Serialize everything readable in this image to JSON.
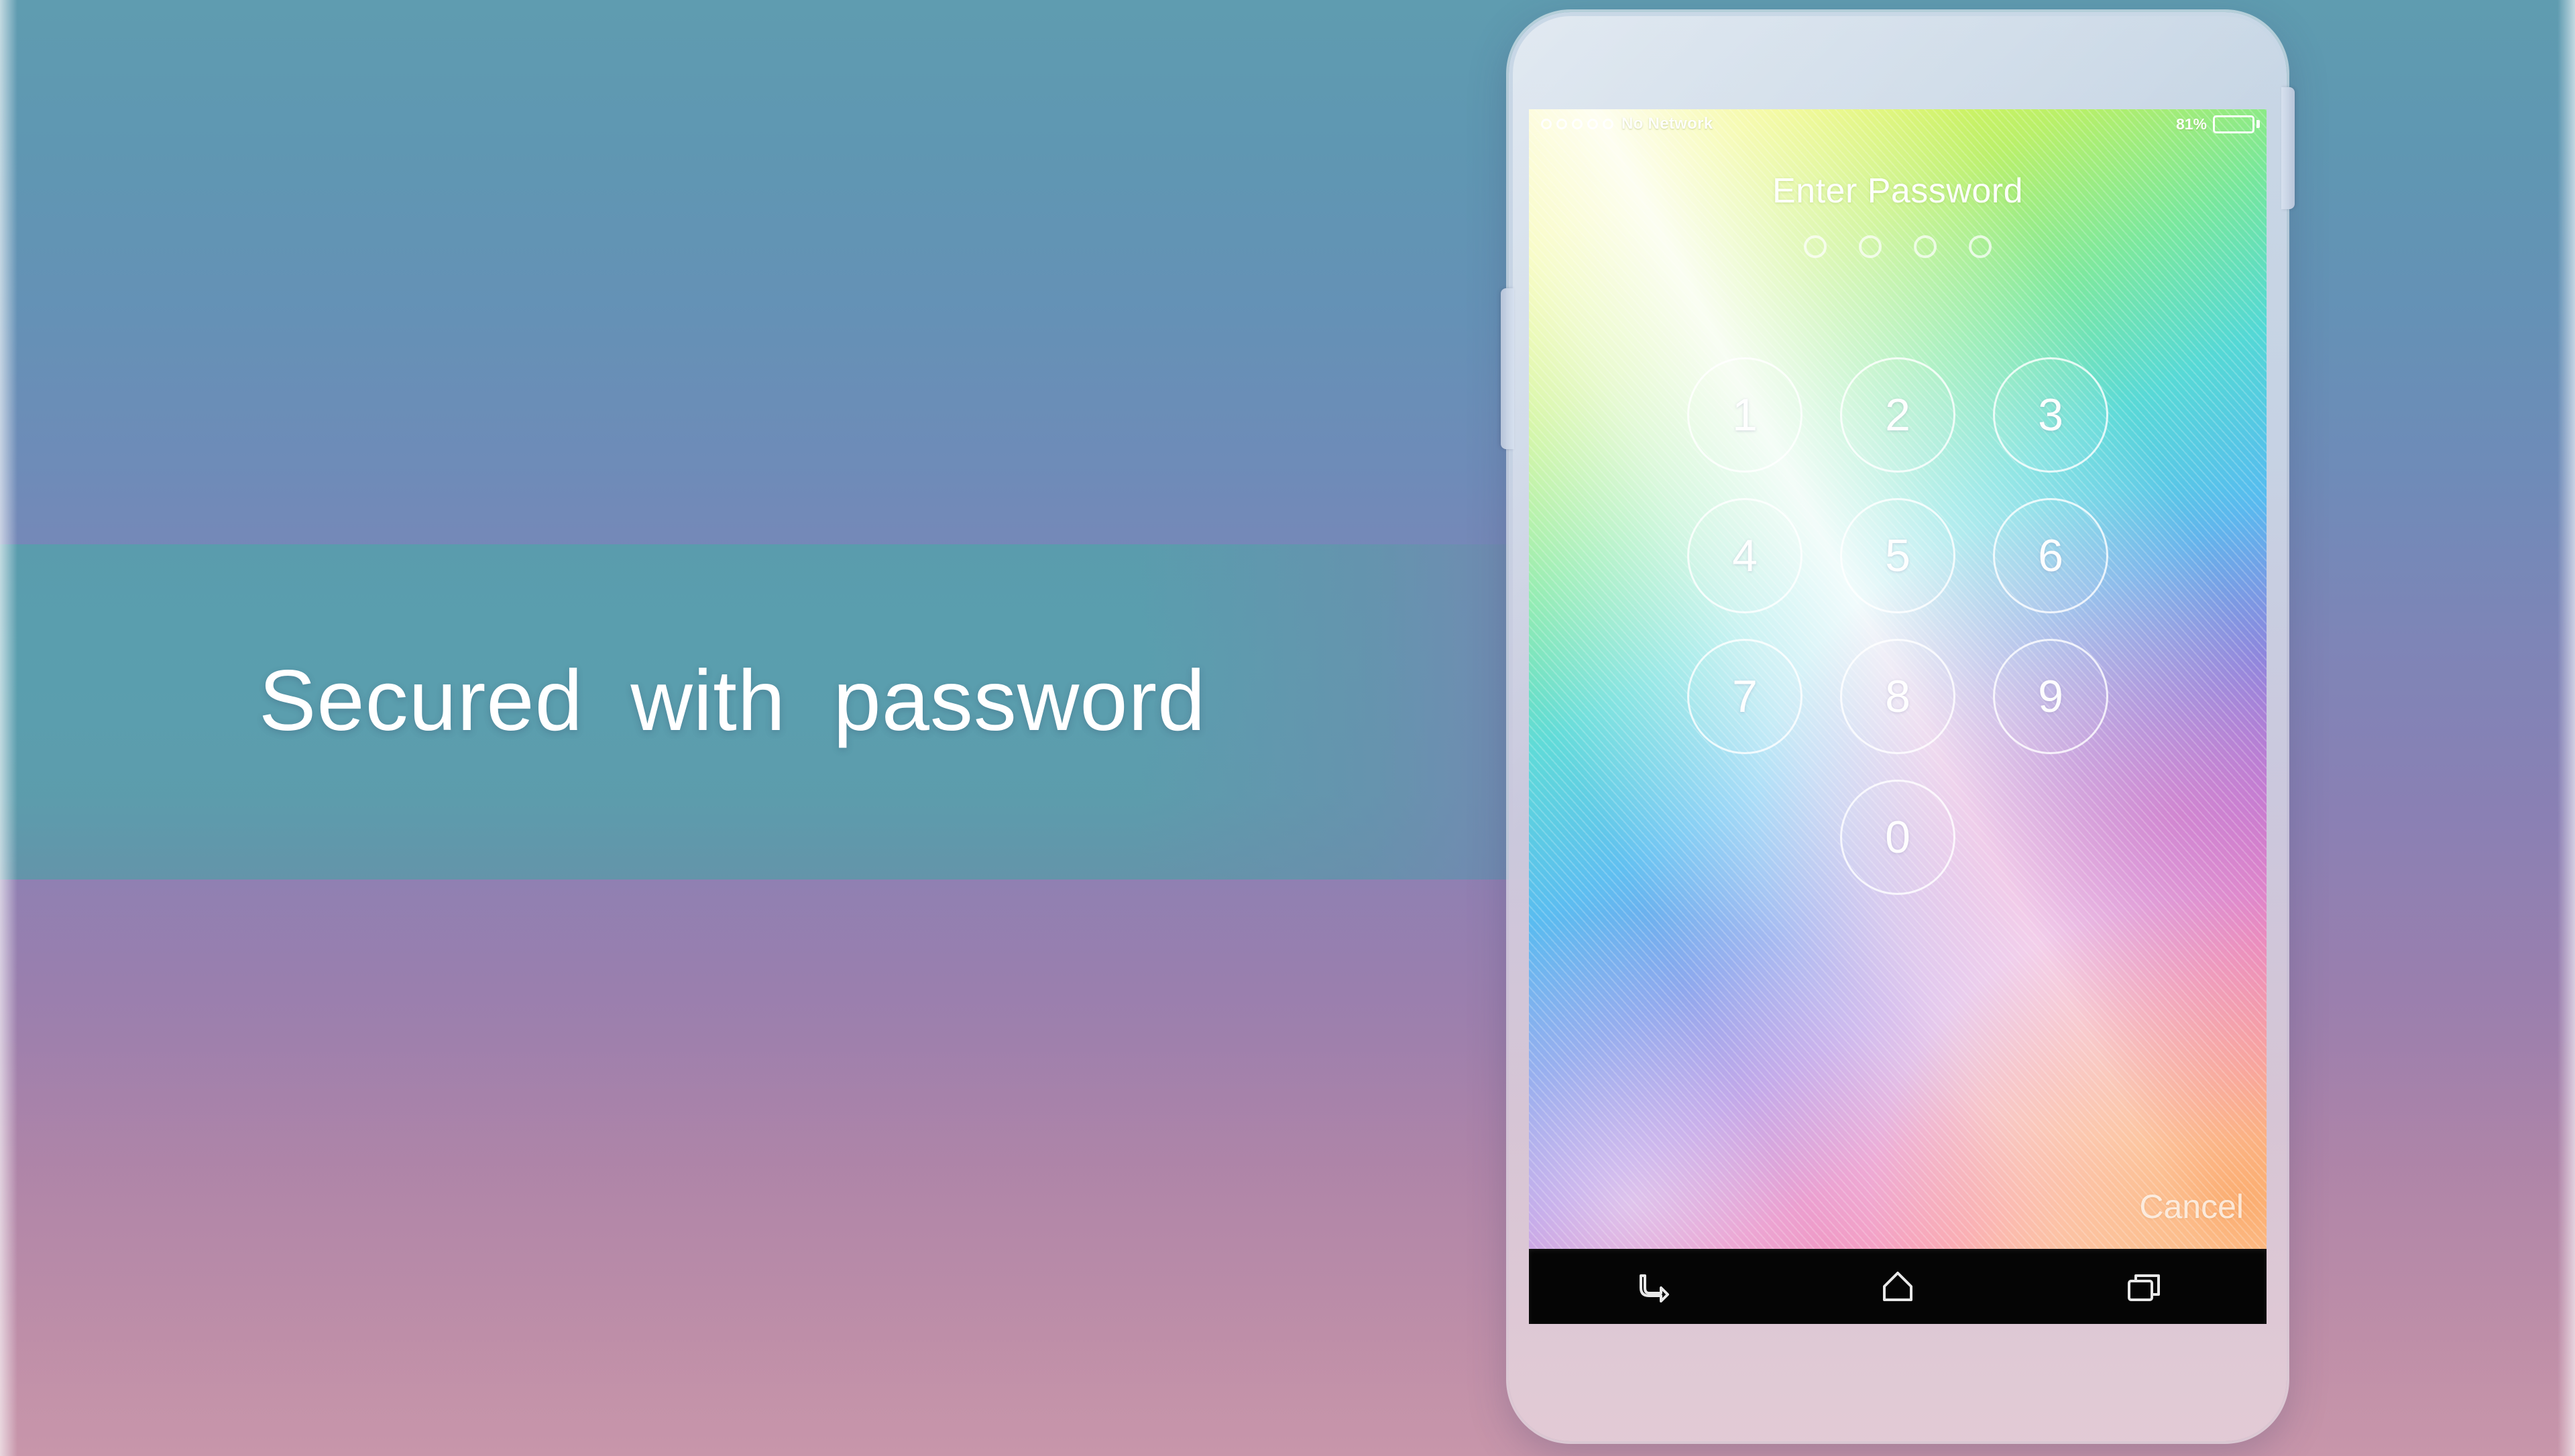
{
  "background": {
    "tagline": "Secured  with  password",
    "band_color": "#589eac",
    "top_color": "#5f9cb0",
    "bottom_color": "#c494a8"
  },
  "phone": {
    "body_color": "#cdd9e7",
    "buttons": {
      "volume_label": "volume-rocker",
      "power_label": "power-button"
    }
  },
  "screen": {
    "statusbar": {
      "signal_dots": 5,
      "carrier": "No Network",
      "battery_percent": "81%",
      "battery_level": 81,
      "battery_color": "#17b24a"
    },
    "lock": {
      "title": "Enter Password",
      "password_dots": 4,
      "entered_count": 0,
      "keys": [
        [
          "1",
          "2",
          "3"
        ],
        [
          "4",
          "5",
          "6"
        ],
        [
          "7",
          "8",
          "9"
        ],
        [
          "",
          "0",
          ""
        ]
      ],
      "cancel_label": "Cancel"
    },
    "wallpaper": {
      "style": "rainbow-diagonal-stripes",
      "colors": [
        "#f6f24e",
        "#76e79a",
        "#4fb8ef",
        "#a279dd",
        "#f573a0",
        "#fba06a"
      ]
    }
  },
  "navbar": {
    "background": "#050505",
    "items": [
      {
        "name": "back",
        "icon": "back-arrow-icon"
      },
      {
        "name": "home",
        "icon": "home-icon"
      },
      {
        "name": "recents",
        "icon": "recents-icon"
      }
    ]
  }
}
